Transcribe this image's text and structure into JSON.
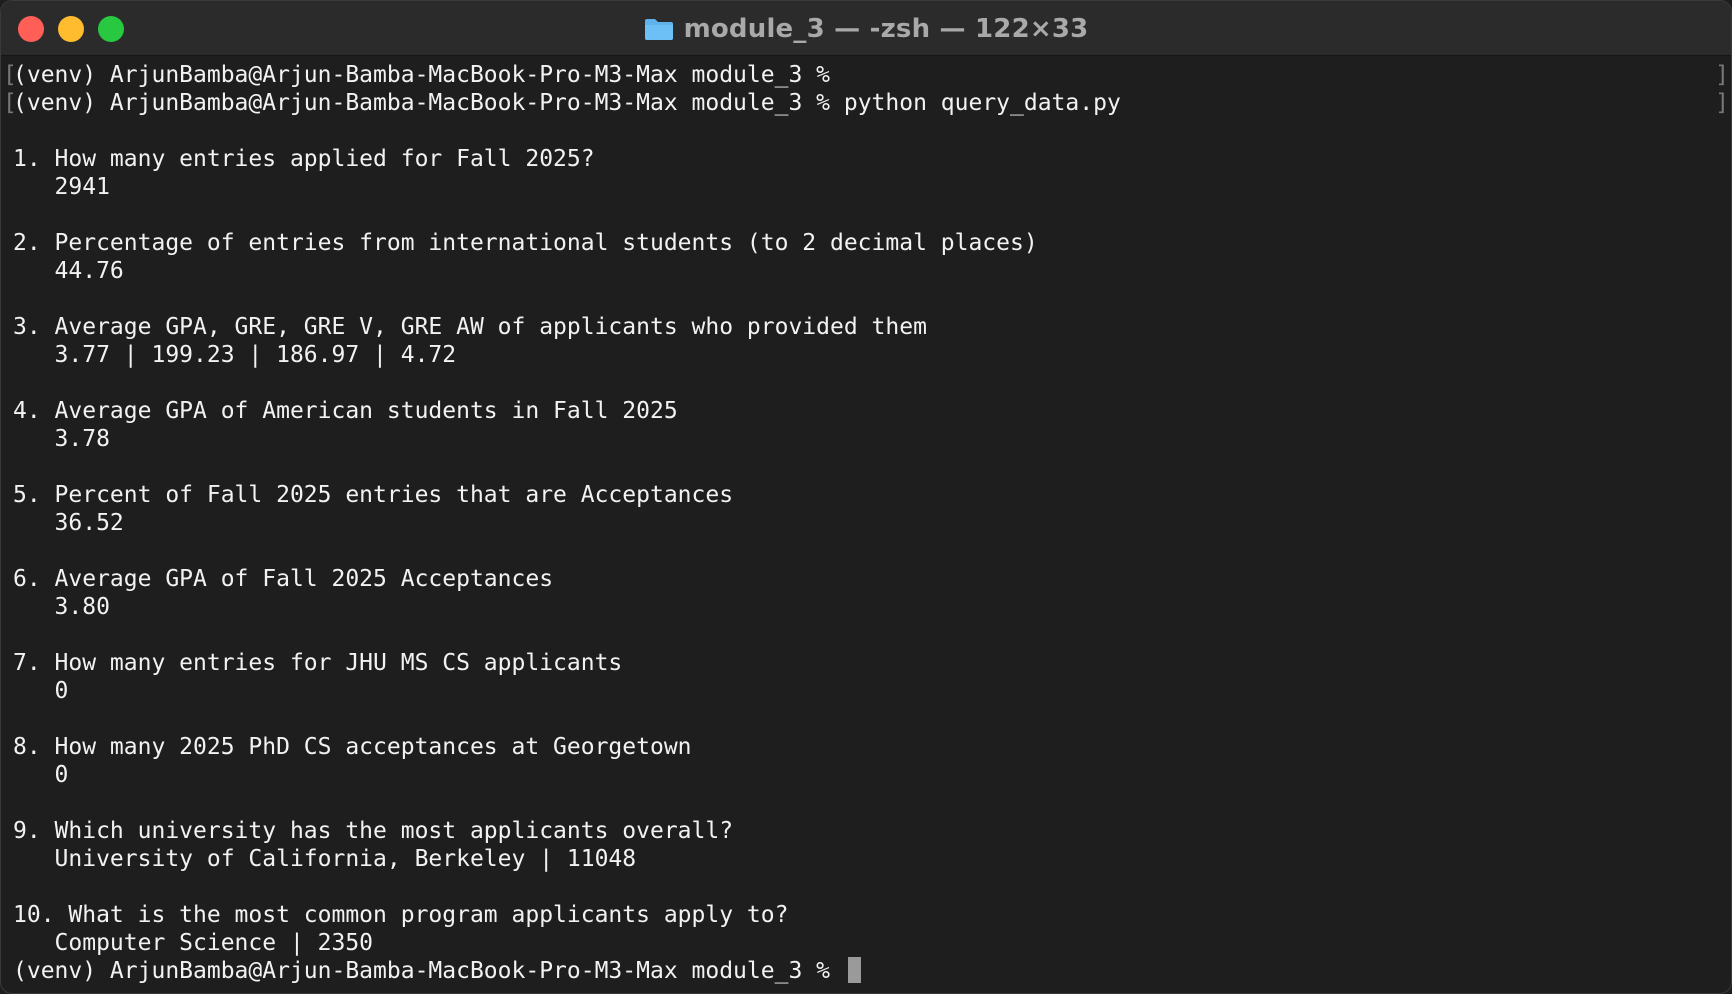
{
  "window": {
    "title": "module_3 — -zsh — 122×33"
  },
  "terminal": {
    "prompt": "(venv) ArjunBamba@Arjun-Bamba-MacBook-Pro-M3-Max module_3 %",
    "command": "python query_data.py",
    "results": [
      {
        "question": "1. How many entries applied for Fall 2025?",
        "answer": "   2941"
      },
      {
        "question": "2. Percentage of entries from international students (to 2 decimal places)",
        "answer": "   44.76"
      },
      {
        "question": "3. Average GPA, GRE, GRE V, GRE AW of applicants who provided them",
        "answer": "   3.77 | 199.23 | 186.97 | 4.72"
      },
      {
        "question": "4. Average GPA of American students in Fall 2025",
        "answer": "   3.78"
      },
      {
        "question": "5. Percent of Fall 2025 entries that are Acceptances",
        "answer": "   36.52"
      },
      {
        "question": "6. Average GPA of Fall 2025 Acceptances",
        "answer": "   3.80"
      },
      {
        "question": "7. How many entries for JHU MS CS applicants",
        "answer": "   0"
      },
      {
        "question": "8. How many 2025 PhD CS acceptances at Georgetown",
        "answer": "   0"
      },
      {
        "question": "9. Which university has the most applicants overall?",
        "answer": "   University of California, Berkeley | 11048"
      },
      {
        "question": "10. What is the most common program applicants apply to?",
        "answer": "   Computer Science | 2350"
      }
    ],
    "final_prompt": "(venv) ArjunBamba@Arjun-Bamba-MacBook-Pro-M3-Max module_3 % "
  }
}
